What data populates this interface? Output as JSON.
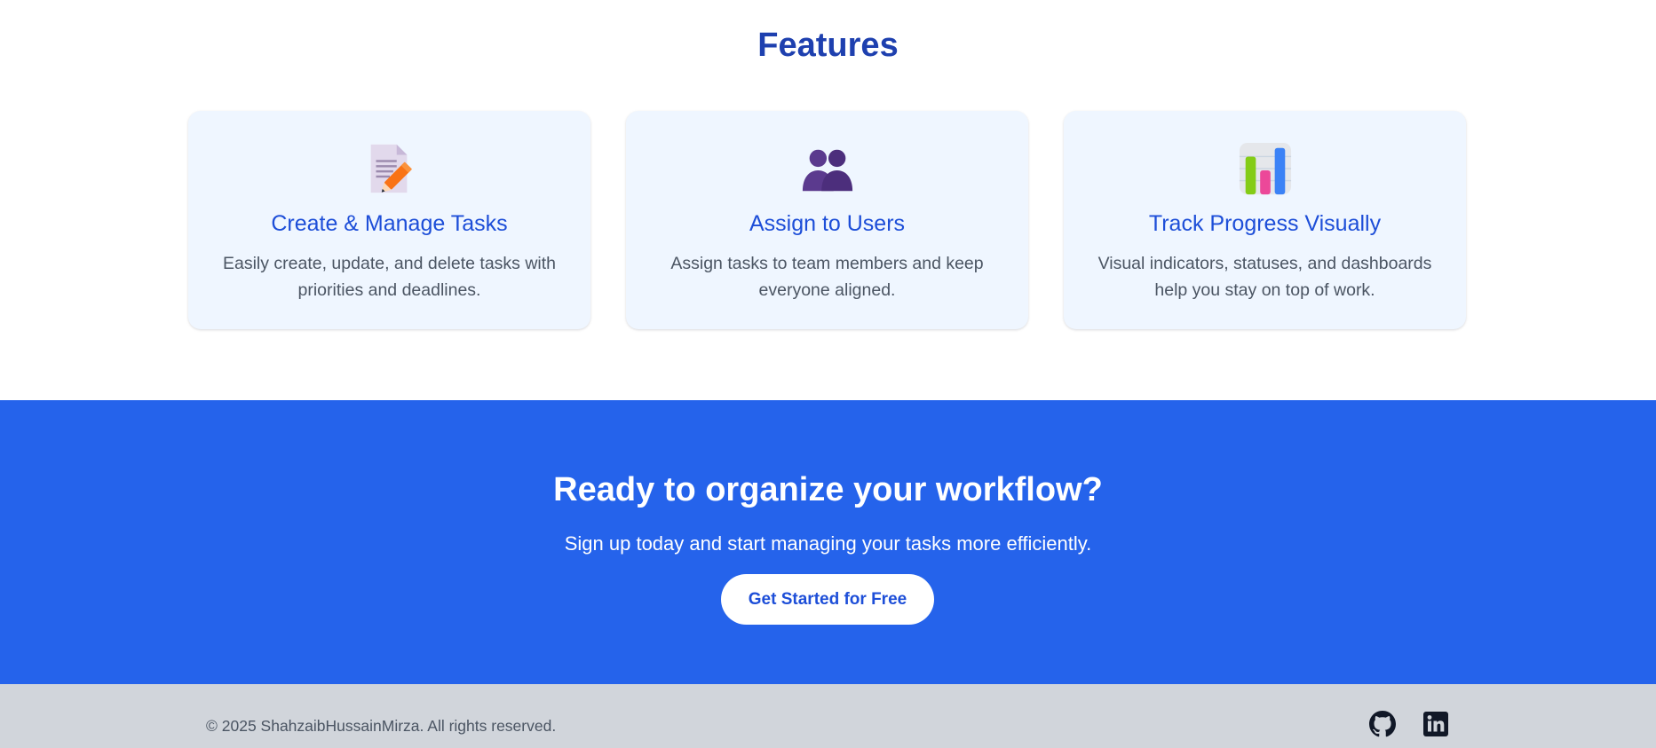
{
  "features": {
    "title": "Features",
    "cards": [
      {
        "icon": "memo-pencil-icon",
        "title": "Create & Manage Tasks",
        "description": "Easily create, update, and delete tasks with priorities and deadlines."
      },
      {
        "icon": "users-icon",
        "title": "Assign to Users",
        "description": "Assign tasks to team members and keep everyone aligned."
      },
      {
        "icon": "bar-chart-icon",
        "title": "Track Progress Visually",
        "description": "Visual indicators, statuses, and dashboards help you stay on top of work."
      }
    ]
  },
  "cta": {
    "title": "Ready to organize your workflow?",
    "subtitle": "Sign up today and start managing your tasks more efficiently.",
    "button_label": "Get Started for Free"
  },
  "footer": {
    "copyright": "© 2025 ShahzaibHussainMirza. All rights reserved.",
    "social": [
      {
        "icon": "github-icon"
      },
      {
        "icon": "linkedin-icon"
      }
    ]
  },
  "colors": {
    "heading_blue": "#1e40af",
    "card_title_blue": "#1d4ed8",
    "card_bg": "#eff6ff",
    "cta_bg": "#2563eb",
    "footer_bg": "#d1d5db"
  }
}
